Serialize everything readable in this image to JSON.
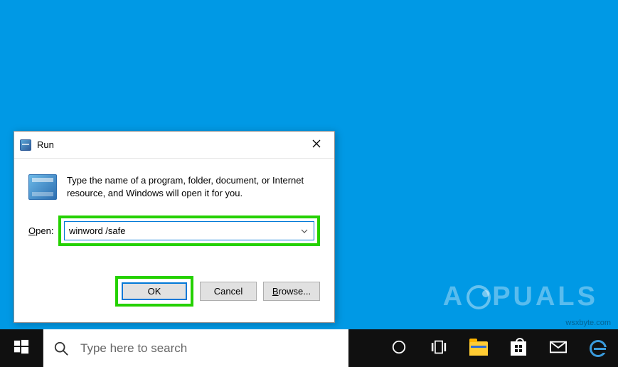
{
  "run_dialog": {
    "title": "Run",
    "description": "Type the name of a program, folder, document, or Internet resource, and Windows will open it for you.",
    "open_label_pre": "O",
    "open_label_post": "pen:",
    "input_value": "winword /safe",
    "buttons": {
      "ok": "OK",
      "cancel": "Cancel",
      "browse_pre": "B",
      "browse_post": "rowse..."
    }
  },
  "taskbar": {
    "search_placeholder": "Type here to search"
  },
  "watermark": {
    "left": "A",
    "right": "PUALS",
    "sub": "wsxbyte.com"
  }
}
